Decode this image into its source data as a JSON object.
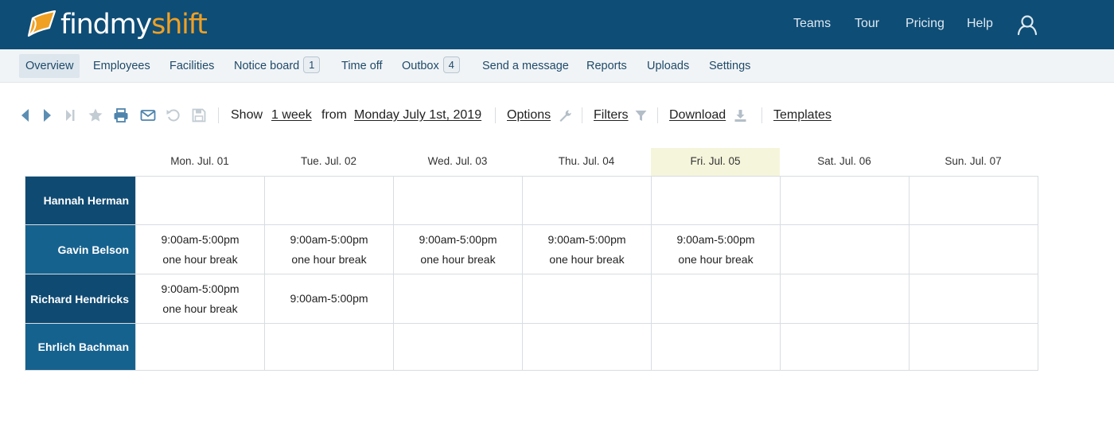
{
  "brand": {
    "name_white": "findmy",
    "name_orange": "shift"
  },
  "topnav": {
    "teams": "Teams",
    "tour": "Tour",
    "pricing": "Pricing",
    "help": "Help",
    "user_icon": "user-icon"
  },
  "subnav": [
    {
      "label": "Overview"
    },
    {
      "label": "Employees"
    },
    {
      "label": "Facilities"
    },
    {
      "label": "Notice board",
      "badge": "1"
    },
    {
      "label": "Time off"
    },
    {
      "label": "Outbox",
      "badge": "4"
    },
    {
      "label": "Send a message"
    },
    {
      "label": "Reports"
    },
    {
      "label": "Uploads"
    },
    {
      "label": "Settings"
    }
  ],
  "toolbar": {
    "icons": [
      "previous-icon",
      "next-icon",
      "last-icon",
      "star-icon",
      "print-icon",
      "email-icon",
      "undo-icon",
      "save-icon"
    ],
    "show_label": "Show",
    "period": "1 week",
    "from_label": "from",
    "start_date": "Monday July 1st, 2019",
    "options": "Options",
    "filters": "Filters",
    "download": "Download",
    "templates": "Templates"
  },
  "schedule": {
    "days": [
      "Mon. Jul. 01",
      "Tue. Jul. 02",
      "Wed. Jul. 03",
      "Thu. Jul. 04",
      "Fri. Jul. 05",
      "Sat. Jul. 06",
      "Sun. Jul. 07"
    ],
    "today_index": 4,
    "employees": [
      {
        "name": "Hannah Herman",
        "shifts": [
          "",
          "",
          "",
          "",
          "",
          "",
          ""
        ],
        "notes": [
          "",
          "",
          "",
          "",
          "",
          "",
          ""
        ]
      },
      {
        "name": "Gavin Belson",
        "shifts": [
          "9:00am-5:00pm",
          "9:00am-5:00pm",
          "9:00am-5:00pm",
          "9:00am-5:00pm",
          "9:00am-5:00pm",
          "",
          ""
        ],
        "notes": [
          "one hour break",
          "one hour break",
          "one hour break",
          "one hour break",
          "one hour break",
          "",
          ""
        ]
      },
      {
        "name": "Richard Hendricks",
        "shifts": [
          "9:00am-5:00pm",
          "9:00am-5:00pm",
          "",
          "",
          "",
          "",
          ""
        ],
        "notes": [
          "one hour break",
          "",
          "",
          "",
          "",
          "",
          ""
        ]
      },
      {
        "name": "Ehrlich Bachman",
        "shifts": [
          "",
          "",
          "",
          "",
          "",
          "",
          ""
        ],
        "notes": [
          "",
          "",
          "",
          "",
          "",
          "",
          ""
        ]
      }
    ]
  },
  "colors": {
    "header_bg": "#0e4d76",
    "brand_orange": "#f0a023",
    "name_cell_dark": "#0f4a72",
    "name_cell_light": "#16628f",
    "today_highlight": "#f5f5dc"
  }
}
